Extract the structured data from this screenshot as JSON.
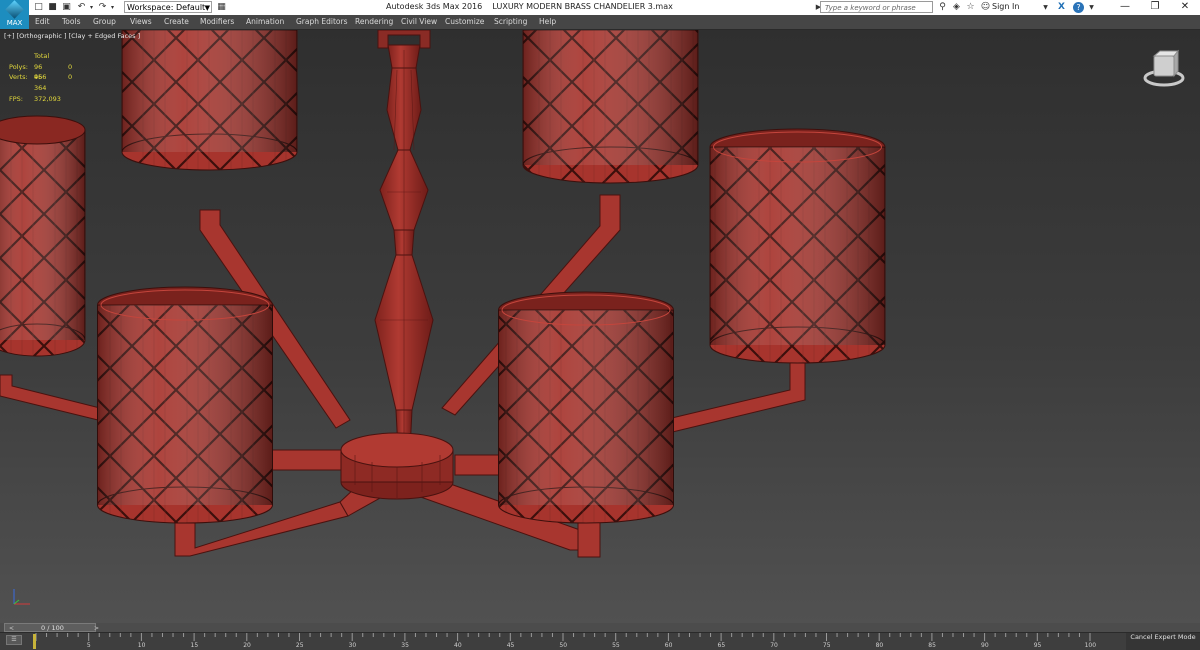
{
  "titlebar": {
    "app_logo_text": "MAX",
    "workspace": "Workspace: Default",
    "app_name": "Autodesk 3ds Max 2016",
    "file_name": "LUXURY MODERN BRASS CHANDELIER 3.max",
    "search_placeholder": "Type a keyword or phrase",
    "sign_in": "Sign In",
    "help_glyph": "?",
    "quick_access_icons": [
      "new-icon",
      "open-icon",
      "save-icon",
      "undo-icon",
      "undo-dropdown-icon",
      "redo-icon",
      "redo-dropdown-icon",
      "project-folder-icon"
    ],
    "toolbar_icons": [
      "search-icon",
      "favorites-icon",
      "star-icon",
      "user-icon",
      "autodesk-x-icon",
      "help-icon"
    ]
  },
  "menu": [
    "Edit",
    "Tools",
    "Group",
    "Views",
    "Create",
    "Modifiers",
    "Animation",
    "Graph Editors",
    "Rendering",
    "Civil View",
    "Customize",
    "Scripting",
    "Help"
  ],
  "viewport": {
    "label": "[+] [Orthographic ] [Clay + Edged Faces ]",
    "stats": {
      "header": "Total",
      "polys_label": "Polys:",
      "polys_value": "96 456",
      "polys_selected": "0",
      "verts_label": "Verts:",
      "verts_value": "96 364",
      "verts_selected": "0",
      "fps_label": "FPS:",
      "fps_value": "372,093"
    },
    "clay_color": "#a2322c"
  },
  "timeline": {
    "current": "0 / 100",
    "ticks": [
      "0",
      "5",
      "10",
      "15",
      "20",
      "25",
      "30",
      "35",
      "40",
      "45",
      "50",
      "55",
      "60",
      "65",
      "70",
      "75",
      "80",
      "85",
      "90",
      "95",
      "100"
    ]
  },
  "status": {
    "cancel_expert_mode": "Cancel Expert Mode"
  }
}
